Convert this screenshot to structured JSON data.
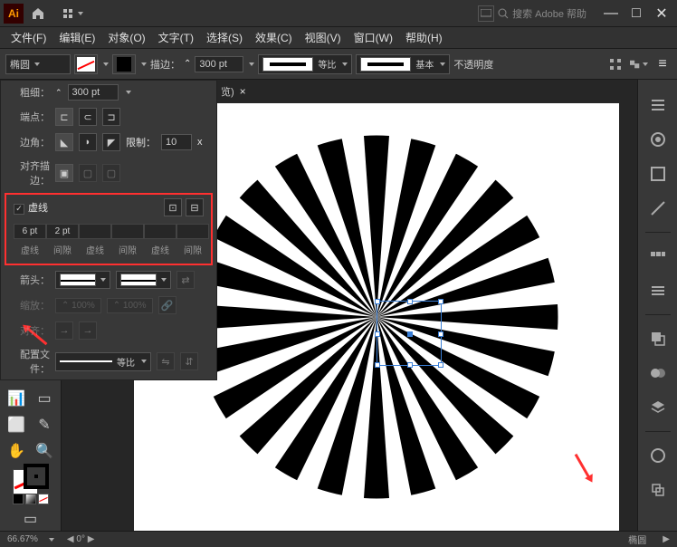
{
  "title_bar": {
    "logo_text": "Ai",
    "search_placeholder": "搜索 Adobe 帮助"
  },
  "menu": {
    "file": "文件(F)",
    "edit": "编辑(E)",
    "object": "对象(O)",
    "type": "文字(T)",
    "select": "选择(S)",
    "effect": "效果(C)",
    "view": "视图(V)",
    "window": "窗口(W)",
    "help": "帮助(H)"
  },
  "control": {
    "shape_label": "椭圆",
    "stroke_label": "描边：",
    "stroke_weight": "300 pt",
    "ratio_label": "等比",
    "basic_label": "基本",
    "opacity_label": "不透明度"
  },
  "stroke_panel": {
    "weight_label": "粗细：",
    "weight_value": "300 pt",
    "cap_label": "端点：",
    "corner_label": "边角：",
    "limit_label": "限制：",
    "limit_value": "10",
    "limit_x": "x",
    "align_label": "对齐描边：",
    "dashed_label": "虚线",
    "dash_values": [
      "6 pt",
      "2 pt",
      "",
      "",
      "",
      ""
    ],
    "dash_headers": [
      "虚线",
      "间隙",
      "虚线",
      "间隙",
      "虚线",
      "间隙"
    ],
    "arrow_label": "箭头：",
    "scale_label": "缩放：",
    "scale_val": "100%",
    "align_arrow_label": "对齐：",
    "profile_label": "配置文件：",
    "profile_val": "等比"
  },
  "tab": {
    "suffix": "览)",
    "close": "×"
  },
  "status": {
    "zoom": "66.67%",
    "shape": "椭圆"
  }
}
